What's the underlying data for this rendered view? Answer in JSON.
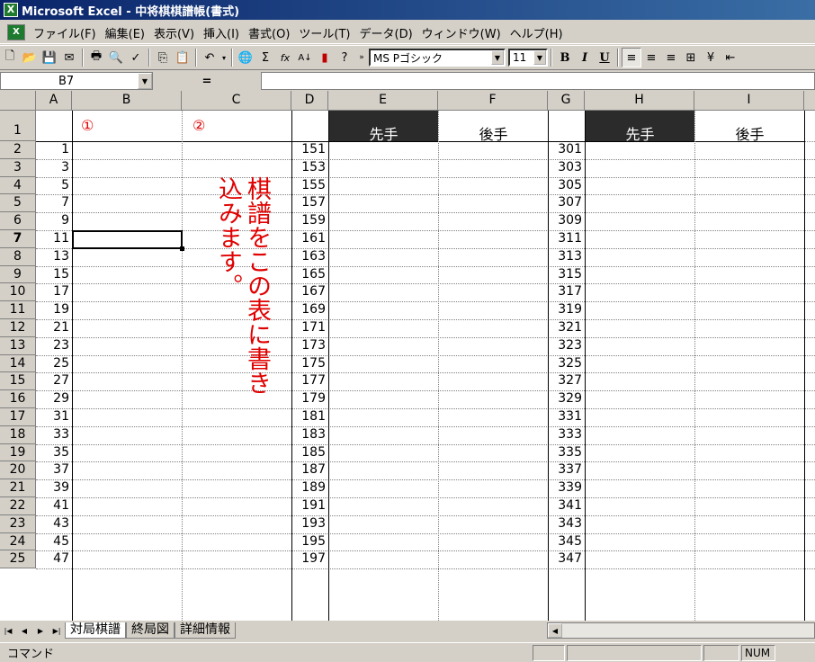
{
  "window": {
    "title": "Microsoft Excel - 中将棋棋譜帳(書式)"
  },
  "menu": [
    "ファイル(F)",
    "編集(E)",
    "表示(V)",
    "挿入(I)",
    "書式(O)",
    "ツール(T)",
    "データ(D)",
    "ウィンドウ(W)",
    "ヘルプ(H)"
  ],
  "toolbar": {
    "font_name": "MS Pゴシック",
    "font_size": "11",
    "bold_label": "B",
    "italic_label": "I",
    "underline_label": "U",
    "sum_label": "Σ",
    "fx_label": "fx",
    "sort_label": "A↓"
  },
  "formula_bar": {
    "name_box": "B7",
    "equals": "="
  },
  "columns": [
    "A",
    "B",
    "C",
    "D",
    "E",
    "F",
    "G",
    "H",
    "I"
  ],
  "rows": [
    "1",
    "2",
    "3",
    "4",
    "5",
    "6",
    "7",
    "8",
    "9",
    "10",
    "11",
    "12",
    "13",
    "14",
    "15",
    "16",
    "17",
    "18",
    "19",
    "20",
    "21",
    "22",
    "23",
    "24",
    "25"
  ],
  "header_row": {
    "b1": "①",
    "c1": "②",
    "e1": "先手",
    "f1": "後手",
    "h1": "先手",
    "i1": "後手"
  },
  "col_a_values": [
    "1",
    "3",
    "5",
    "7",
    "9",
    "11",
    "13",
    "15",
    "17",
    "19",
    "21",
    "23",
    "25",
    "27",
    "29",
    "31",
    "33",
    "35",
    "37",
    "39",
    "41",
    "43",
    "45",
    "47"
  ],
  "col_d_values": [
    "151",
    "153",
    "155",
    "157",
    "159",
    "161",
    "163",
    "165",
    "167",
    "169",
    "171",
    "173",
    "175",
    "177",
    "179",
    "181",
    "183",
    "185",
    "187",
    "189",
    "191",
    "193",
    "195",
    "197"
  ],
  "col_g_values": [
    "301",
    "303",
    "305",
    "307",
    "309",
    "311",
    "313",
    "315",
    "317",
    "319",
    "321",
    "323",
    "325",
    "327",
    "329",
    "331",
    "333",
    "335",
    "337",
    "339",
    "341",
    "343",
    "345",
    "347"
  ],
  "annotation": {
    "line1": "棋譜をこの表に書き",
    "line2": "込みます。"
  },
  "sheet_tabs": [
    "対局棋譜",
    "終局図",
    "詳細情報"
  ],
  "status": {
    "mode": "コマンド",
    "num": "NUM"
  },
  "colors": {
    "header_dark": "#2b2b2b",
    "annotation_red": "#e00000"
  }
}
